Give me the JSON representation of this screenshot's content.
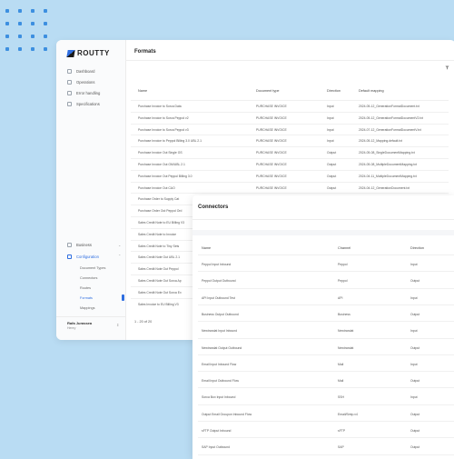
{
  "app": {
    "logo_text": "ROUTTY"
  },
  "sidebar": {
    "items": [
      {
        "label": "Dashboard",
        "icon": "grid-icon"
      },
      {
        "label": "Operations",
        "icon": "document-icon"
      },
      {
        "label": "Error handling",
        "icon": "document-icon"
      },
      {
        "label": "Specifications",
        "icon": "pin-icon"
      }
    ],
    "bottom_items": [
      {
        "label": "Business",
        "icon": "box-icon"
      },
      {
        "label": "Configuration",
        "icon": "gear-icon"
      }
    ],
    "config_sub": [
      "Document Types",
      "Connectors",
      "Routes",
      "Formats",
      "Mappings"
    ],
    "active_sub": "Formats",
    "user": {
      "name": "Rafa Jurassea",
      "role": "Henry"
    }
  },
  "formats": {
    "title": "Formats",
    "columns": [
      "Name",
      "Document type",
      "Direction",
      "Default mapping"
    ],
    "rows": [
      [
        "Purchase Invoice to Sorca Data",
        "PURCHASE INVOICE",
        "Input",
        "2024-05-12_GenerationFormatDocument.txt"
      ],
      [
        "Purchase Invoice to Sorca Peppol v2",
        "PURCHASE INVOICE",
        "Input",
        "2024-05-12_GenerationFormatDocumentV2.txt"
      ],
      [
        "Purchase Invoice to Sorca Peppol v3",
        "PURCHASE INVOICE",
        "Input",
        "2024-07-12_GenerationFormatDocumentV.txt"
      ],
      [
        "Purchase Invoice to Peppol Billing 3.0 UBL 2.1",
        "PURCHASE INVOICE",
        "Input",
        "2024-05-12_Mapping.default.txt"
      ],
      [
        "Purchase Invoice Out Single GS",
        "PURCHASE INVOICE",
        "Output",
        "2024-05-08_SingleDocumentMapping.txt"
      ],
      [
        "Purchase Invoice Out GM/UBL 2.1",
        "PURCHASE INVOICE",
        "Output",
        "2024-05-08_MultipleDocumentMapping.txt"
      ],
      [
        "Purchase Invoice Out Peppol Billing 3.0",
        "PURCHASE INVOICE",
        "Output",
        "2024-04-11_MultipleDocumentMapping.txt"
      ],
      [
        "Purchase Invoice Out CAO",
        "PURCHASE INVOICE",
        "Output",
        "2024-04-12_GenerationDocument.txt"
      ],
      [
        "Purchase Order to Supply Cat",
        "",
        "",
        ""
      ],
      [
        "Purchase Order Out Peppol Ord",
        "",
        "",
        ""
      ],
      [
        "Sales Credit Note to EU Billing V3",
        "",
        "",
        ""
      ],
      [
        "Sales Credit Note to Invoice",
        "",
        "",
        ""
      ],
      [
        "Sales Credit Note to Tiny Sets",
        "",
        "",
        ""
      ],
      [
        "Sales Credit Note Out UBL 2.1",
        "",
        "",
        ""
      ],
      [
        "Sales Credit Note Out Peppol",
        "",
        "",
        ""
      ],
      [
        "Sales Credit Note Out Sorca Ap",
        "",
        "",
        ""
      ],
      [
        "Sales Credit Note Out Sorca Ex",
        "",
        "",
        ""
      ],
      [
        "Sales Invoice to EU Billing V3",
        "",
        "",
        ""
      ]
    ],
    "pager": "1 - 20 of 20"
  },
  "connectors": {
    "title": "Connectors",
    "columns": [
      "Name",
      "Channel",
      "Direction"
    ],
    "rows": [
      [
        "Peppol Input Inbound",
        "Peppol",
        "Input"
      ],
      [
        "Peppol Output Outbound",
        "Peppol",
        "Output"
      ],
      [
        "API Input Outbound Test",
        "API",
        "Input"
      ],
      [
        "Business Output Outbound",
        "Business",
        "Output"
      ],
      [
        "Newtrandat Input Inbound",
        "Newtrandat",
        "Input"
      ],
      [
        "Newtrandat Output Outbound",
        "Newtrandat",
        "Output"
      ],
      [
        "Email Input Inbound Flow",
        "Mail",
        "Input"
      ],
      [
        "Email Input Outbound Flow",
        "Mail",
        "Output"
      ],
      [
        "Sorca Box Input Inbound",
        "SSH",
        "Input"
      ],
      [
        "Output Email Groupon Inbound Flow",
        "Email/Smtp.v4",
        "Output"
      ],
      [
        "sFTP Output Inbound",
        "sFTP",
        "Output"
      ],
      [
        "SAP Input Outbound",
        "SAP",
        "Output"
      ],
      [
        "SAP Input Outbound",
        "SAP",
        "Input"
      ]
    ]
  }
}
